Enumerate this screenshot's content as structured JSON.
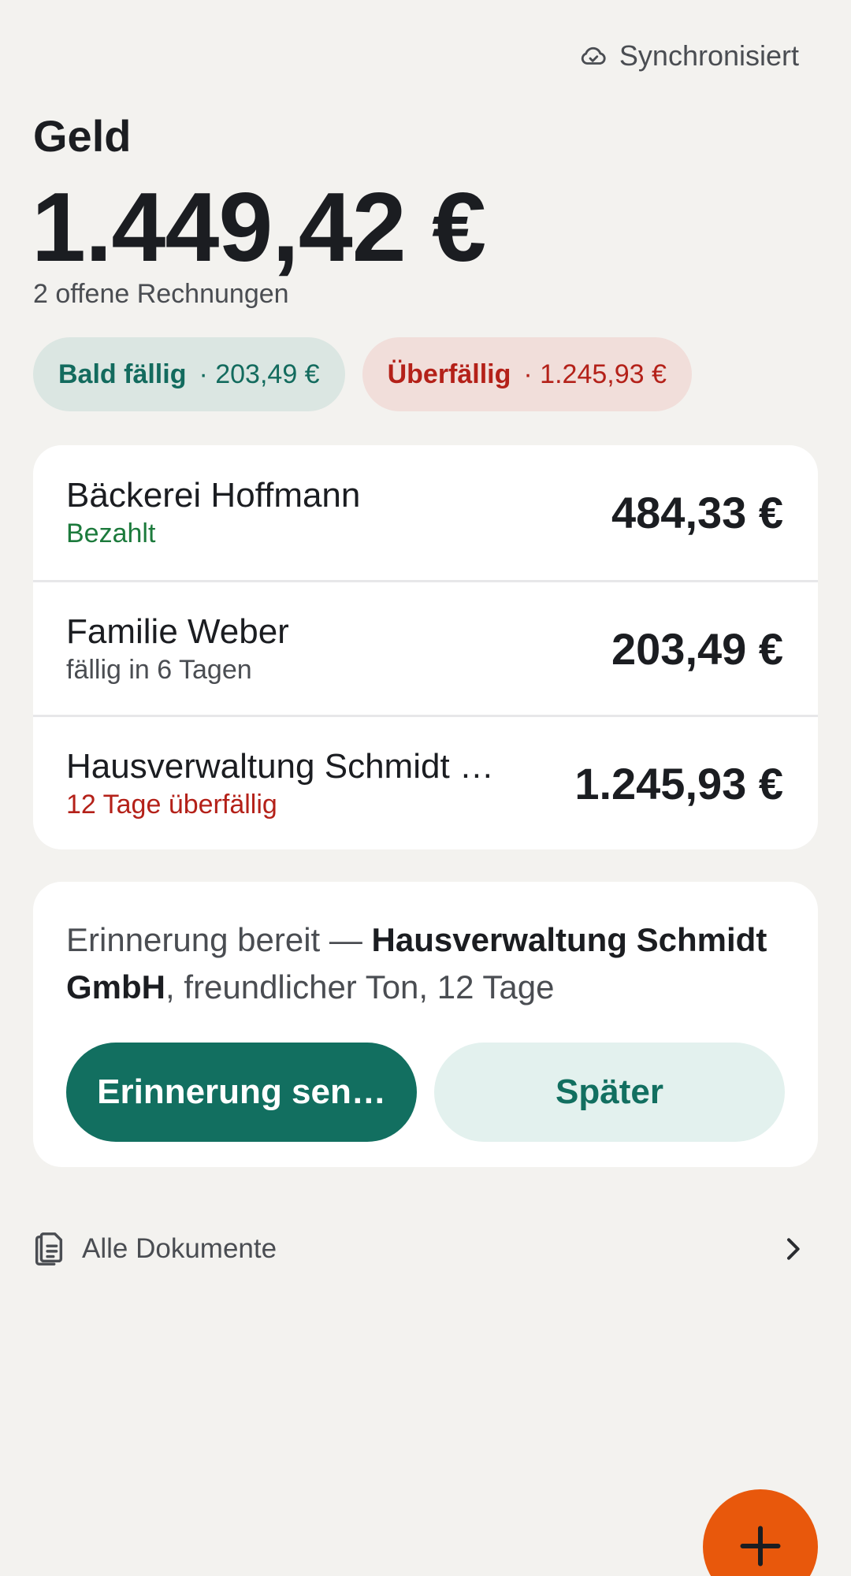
{
  "header": {
    "sync_status": "Synchronisiert",
    "sync_icon": "cloud-check-icon"
  },
  "summary": {
    "title": "Geld",
    "total": "1.449,42 €",
    "open_invoices": "2 offene Rechnungen"
  },
  "chips": {
    "soon_label": "Bald fällig",
    "soon_amount": "· 203,49 €",
    "overdue_label": "Überfällig",
    "overdue_amount": "· 1.245,93 €"
  },
  "invoices": [
    {
      "name": "Bäckerei Hoffmann",
      "status": "Bezahlt",
      "amount": "484,33 €"
    },
    {
      "name": "Familie Weber",
      "status": "fällig in 6 Tagen",
      "amount": "203,49 €"
    },
    {
      "name": "Hausverwaltung Schmidt …",
      "status": "12 Tage überfällig",
      "amount": "1.245,93 €"
    }
  ],
  "reminder": {
    "prefix": "Erinnerung bereit — ",
    "recipient": "Hausverwaltung Schmidt GmbH",
    "suffix": ", freundlicher Ton, 12 Tage",
    "send_label": "Erinnerung sen…",
    "later_label": "Später"
  },
  "documents": {
    "label": "Alle Dokumente",
    "icon": "document-icon"
  },
  "fab": {
    "icon": "plus-icon"
  },
  "colors": {
    "background": "#f3f2ef",
    "accent": "#126f60",
    "overdue": "#b42119",
    "paid": "#1c7a3c",
    "fab": "#e8580c"
  }
}
